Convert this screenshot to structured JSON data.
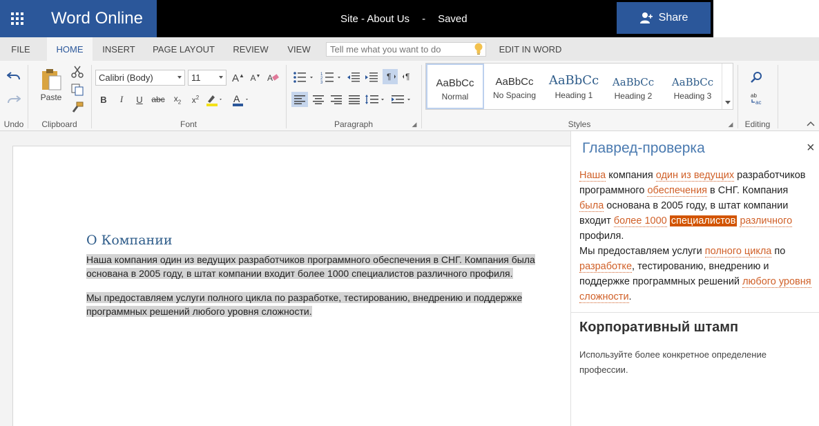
{
  "app": {
    "name": "Word Online",
    "doc_name": "Site - About Us",
    "separator": "-",
    "status": "Saved",
    "share_label": "Share"
  },
  "tabs": [
    {
      "label": "FILE"
    },
    {
      "label": "HOME"
    },
    {
      "label": "INSERT"
    },
    {
      "label": "PAGE LAYOUT"
    },
    {
      "label": "REVIEW"
    },
    {
      "label": "VIEW"
    },
    {
      "label": "EDIT IN WORD"
    }
  ],
  "tellme": {
    "placeholder": "Tell me what you want to do"
  },
  "ribbon": {
    "groups": {
      "undo": "Undo",
      "clipboard": "Clipboard",
      "font": "Font",
      "paragraph": "Paragraph",
      "styles": "Styles",
      "editing": "Editing"
    },
    "paste_label": "Paste",
    "font_name": "Calibri (Body)",
    "font_size": "11",
    "styles": [
      {
        "sample": "AaBbCc",
        "name": "Normal"
      },
      {
        "sample": "AaBbCc",
        "name": "No Spacing"
      },
      {
        "sample": "AaBbCc",
        "name": "Heading 1"
      },
      {
        "sample": "AaBbCc",
        "name": "Heading 2"
      },
      {
        "sample": "AaBbCc",
        "name": "Heading 3"
      }
    ],
    "accent": "#2b579a"
  },
  "document": {
    "heading": "О Компании",
    "paragraphs": [
      "Наша компания один из ведущих разработчиков программного обеспечения в СНГ. Компания была основана в 2005 году, в штат компании входит более 1000 специалистов различного профиля.",
      "Мы предоставляем услуги полного цикла по разработке, тестированию, внедрению и поддержке программных решений любого уровня сложности."
    ]
  },
  "panel": {
    "title": "Главред-проверка",
    "close": "×",
    "segments": [
      {
        "t": "Наша",
        "k": "w"
      },
      {
        "t": " компания ",
        "k": ""
      },
      {
        "t": "один из ведущих",
        "k": "w"
      },
      {
        "t": " разработчиков программного ",
        "k": ""
      },
      {
        "t": "обеспечения",
        "k": "w"
      },
      {
        "t": " в СНГ. Компания ",
        "k": ""
      },
      {
        "t": "была",
        "k": "w"
      },
      {
        "t": " основана в 2005 году, в штат компании входит ",
        "k": ""
      },
      {
        "t": "более 1000",
        "k": "w"
      },
      {
        "t": " ",
        "k": ""
      },
      {
        "t": "специалистов",
        "k": "cur"
      },
      {
        "t": " ",
        "k": ""
      },
      {
        "t": "различного",
        "k": "w"
      },
      {
        "t": " профиля.",
        "k": ""
      },
      {
        "t": "\n",
        "k": "br"
      },
      {
        "t": "Мы предоставляем услуги ",
        "k": ""
      },
      {
        "t": "полного цикла",
        "k": "w"
      },
      {
        "t": " по ",
        "k": ""
      },
      {
        "t": "разработке",
        "k": "w"
      },
      {
        "t": ", тестированию, внедрению и поддержке программных решений ",
        "k": ""
      },
      {
        "t": "любого уровня сложности",
        "k": "w"
      },
      {
        "t": ".",
        "k": ""
      }
    ],
    "tip_title": "Корпоративный штамп",
    "tip_text": "Используйте более конкретное определение профессии."
  }
}
